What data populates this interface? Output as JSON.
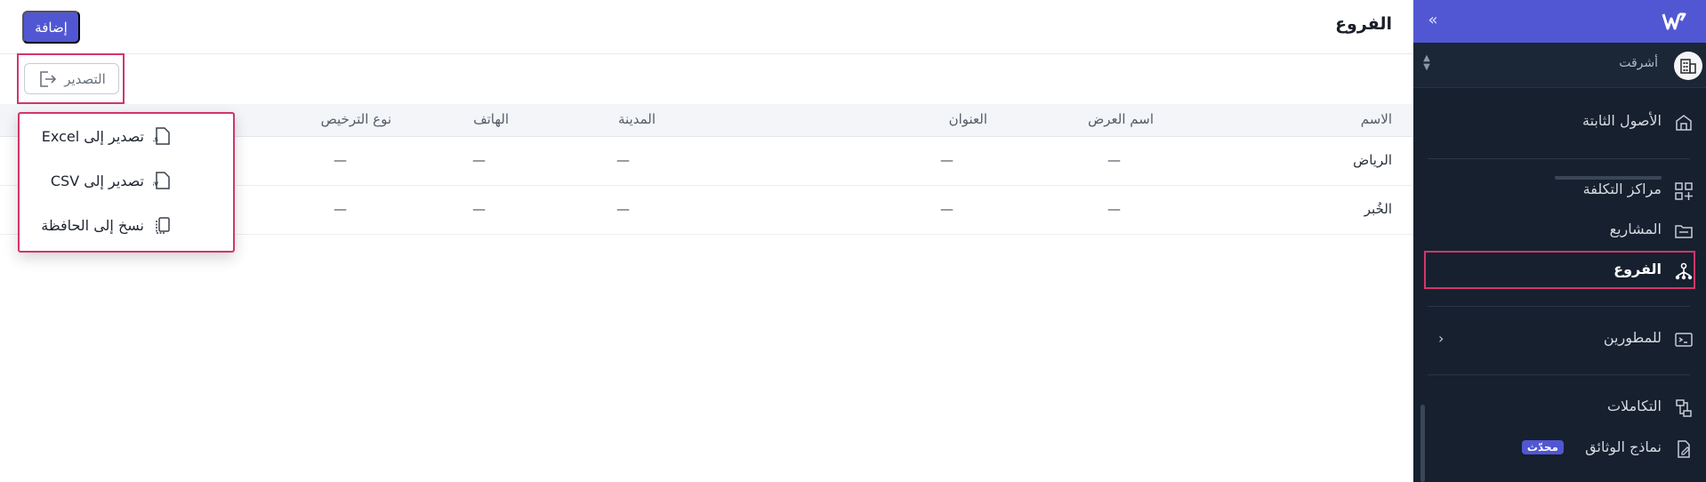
{
  "app": {
    "brand_color": "#5157d3",
    "highlight_color": "#d1366b"
  },
  "sidebar": {
    "collapse_icon": "double-chevron-icon",
    "org": {
      "name": "أشرقت",
      "icon": "building-icon"
    },
    "items": [
      {
        "label": "الأصول الثابتة",
        "icon": "building-assets-icon"
      },
      {
        "label": "مراكز التكلفة",
        "icon": "grid-plus-icon"
      },
      {
        "label": "المشاريع",
        "icon": "folder-icon"
      },
      {
        "label": "الفروع",
        "icon": "branches-icon",
        "active": true
      },
      {
        "label": "للمطورين",
        "icon": "terminal-icon"
      },
      {
        "label": "التكاملات",
        "icon": "integrations-icon"
      },
      {
        "label": "نماذج الوثائق",
        "icon": "document-edit-icon",
        "badge": "محدّث"
      }
    ]
  },
  "header": {
    "title": "الفروع",
    "add_label": "إضافة"
  },
  "toolbar": {
    "export_label": "التصدير"
  },
  "export_menu": {
    "items": [
      {
        "label": "تصدير إلى Excel",
        "icon": "xls-file-icon"
      },
      {
        "label": "تصدير إلى CSV",
        "icon": "csv-file-icon"
      },
      {
        "label": "نسخ إلى الحافظة",
        "icon": "clipboard-icon"
      }
    ]
  },
  "table": {
    "columns": [
      "الاسم",
      "اسم العرض",
      "العنوان",
      "المدينة",
      "الهاتف",
      "نوع الترخيص"
    ],
    "rows": [
      [
        "الرياض",
        "—",
        "—",
        "—",
        "—",
        "—"
      ],
      [
        "الخُبر",
        "—",
        "—",
        "—",
        "—",
        "—"
      ]
    ]
  }
}
